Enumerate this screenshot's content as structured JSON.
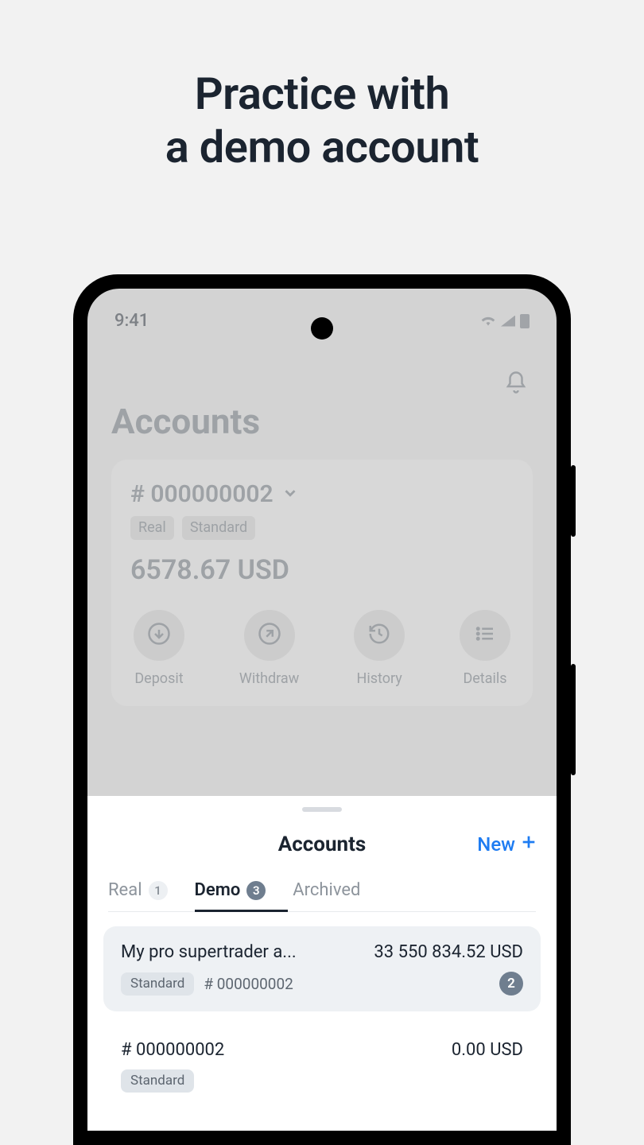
{
  "headline_line1": "Practice with",
  "headline_line2": "a demo account",
  "status": {
    "time": "9:41"
  },
  "page_title": "Accounts",
  "current_account": {
    "number": "# 000000002",
    "chips": {
      "real": "Real",
      "type": "Standard"
    },
    "balance": "6578.67 USD"
  },
  "actions": {
    "deposit": "Deposit",
    "withdraw": "Withdraw",
    "history": "History",
    "details": "Details"
  },
  "sheet": {
    "title": "Accounts",
    "new_label": "New",
    "tabs": {
      "real": {
        "label": "Real",
        "count": "1"
      },
      "demo": {
        "label": "Demo",
        "count": "3"
      },
      "archived": {
        "label": "Archived"
      }
    },
    "items": [
      {
        "name": "My pro supertrader a...",
        "amount": "33 550 834.52 USD",
        "chip": "Standard",
        "number": "# 000000002",
        "flag_count": "2"
      },
      {
        "name": "# 000000002",
        "amount": "0.00 USD",
        "chip": "Standard"
      }
    ]
  }
}
